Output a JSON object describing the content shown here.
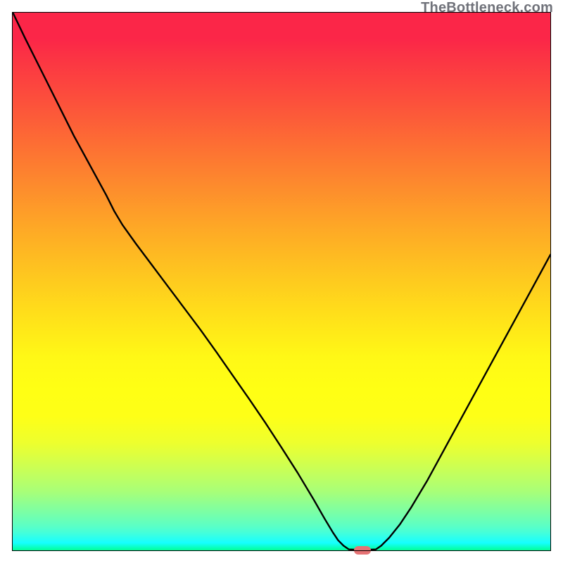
{
  "watermark": "TheBottleneck.com",
  "colors": {
    "curve_stroke": "#000000",
    "marker_fill": "#e67375",
    "border": "#000000",
    "gradient_top": "#fb2648",
    "gradient_bottom": "#00ff8d"
  },
  "chart_data": {
    "type": "line",
    "title": "",
    "xlabel": "",
    "ylabel": "",
    "xlim": [
      0,
      100
    ],
    "ylim": [
      0,
      100
    ],
    "series": [
      {
        "name": "bottleneck-curve",
        "points": [
          {
            "x": 0.1,
            "y": 100.0
          },
          {
            "x": 2.5,
            "y": 95.0
          },
          {
            "x": 5.5,
            "y": 89.0
          },
          {
            "x": 8.5,
            "y": 83.0
          },
          {
            "x": 11.5,
            "y": 77.0
          },
          {
            "x": 14.5,
            "y": 71.5
          },
          {
            "x": 17.5,
            "y": 66.0
          },
          {
            "x": 19.0,
            "y": 63.0
          },
          {
            "x": 20.5,
            "y": 60.5
          },
          {
            "x": 23.0,
            "y": 57.0
          },
          {
            "x": 26.0,
            "y": 53.0
          },
          {
            "x": 29.0,
            "y": 49.0
          },
          {
            "x": 32.0,
            "y": 45.0
          },
          {
            "x": 35.0,
            "y": 41.0
          },
          {
            "x": 38.0,
            "y": 36.8
          },
          {
            "x": 41.0,
            "y": 32.5
          },
          {
            "x": 44.0,
            "y": 28.2
          },
          {
            "x": 47.0,
            "y": 23.8
          },
          {
            "x": 50.0,
            "y": 19.2
          },
          {
            "x": 53.0,
            "y": 14.5
          },
          {
            "x": 56.0,
            "y": 9.5
          },
          {
            "x": 58.0,
            "y": 6.0
          },
          {
            "x": 59.5,
            "y": 3.5
          },
          {
            "x": 60.5,
            "y": 2.0
          },
          {
            "x": 61.5,
            "y": 1.0
          },
          {
            "x": 62.5,
            "y": 0.3
          },
          {
            "x": 65.0,
            "y": 0.2
          },
          {
            "x": 67.5,
            "y": 0.3
          },
          {
            "x": 68.5,
            "y": 1.0
          },
          {
            "x": 70.0,
            "y": 2.5
          },
          {
            "x": 72.0,
            "y": 5.0
          },
          {
            "x": 74.0,
            "y": 8.0
          },
          {
            "x": 77.0,
            "y": 13.0
          },
          {
            "x": 80.0,
            "y": 18.5
          },
          {
            "x": 83.0,
            "y": 24.0
          },
          {
            "x": 86.0,
            "y": 29.5
          },
          {
            "x": 89.0,
            "y": 35.0
          },
          {
            "x": 92.0,
            "y": 40.5
          },
          {
            "x": 95.0,
            "y": 46.0
          },
          {
            "x": 98.0,
            "y": 51.5
          },
          {
            "x": 99.9,
            "y": 55.0
          }
        ]
      }
    ],
    "annotations": [
      {
        "name": "optimal-marker",
        "x": 65.0,
        "y": 0.2
      }
    ]
  }
}
